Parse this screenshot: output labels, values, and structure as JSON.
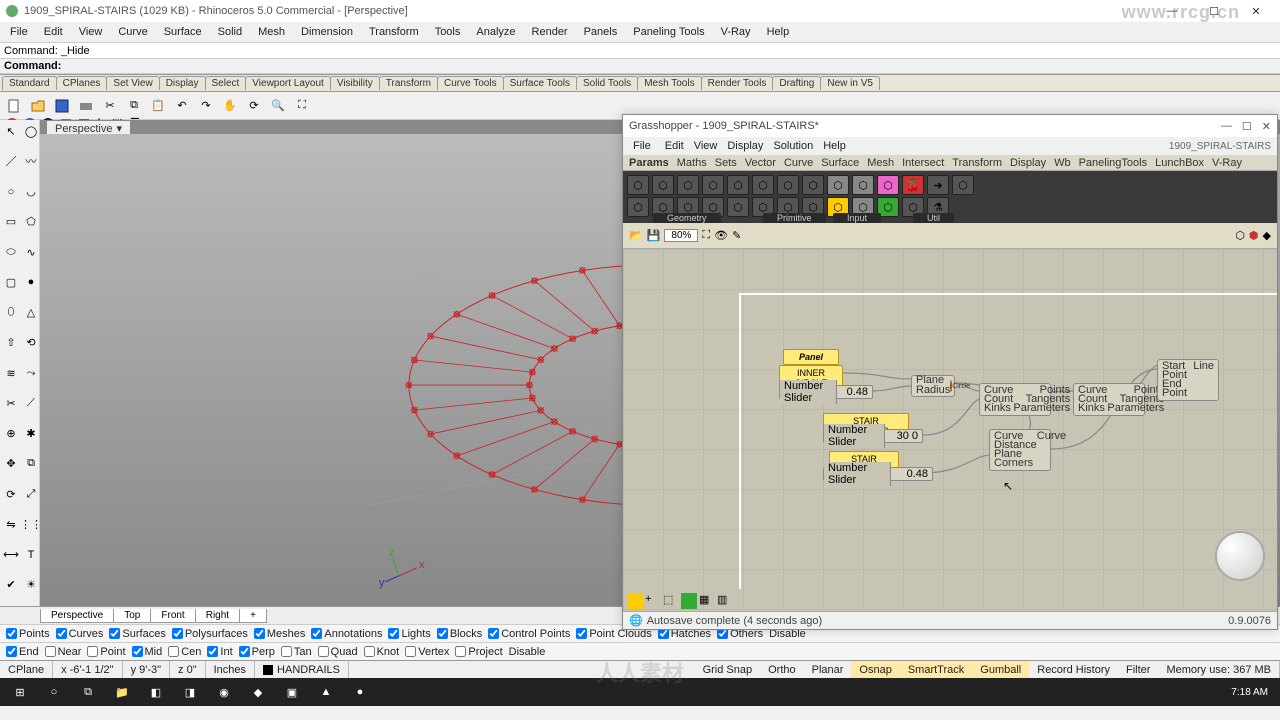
{
  "app": {
    "title": "1909_SPIRAL-STAIRS (1029 KB) - Rhinoceros 5.0 Commercial - [Perspective]",
    "watermark": "www.rrcg.cn",
    "watermark2": "人人素材"
  },
  "menus": [
    "File",
    "Edit",
    "View",
    "Curve",
    "Surface",
    "Solid",
    "Mesh",
    "Dimension",
    "Transform",
    "Tools",
    "Analyze",
    "Render",
    "Panels",
    "Paneling Tools",
    "V-Ray",
    "Help"
  ],
  "command": {
    "history": "Command: _Hide",
    "prompt": "Command:"
  },
  "tabs": [
    "Standard",
    "CPlanes",
    "Set View",
    "Display",
    "Select",
    "Viewport Layout",
    "Visibility",
    "Transform",
    "Curve Tools",
    "Surface Tools",
    "Solid Tools",
    "Mesh Tools",
    "Render Tools",
    "Drafting",
    "New in V5"
  ],
  "viewport": {
    "label": "Perspective"
  },
  "bottom_tabs": [
    "Perspective",
    "Top",
    "Front",
    "Right"
  ],
  "filters1": [
    "End",
    "Near",
    "Point",
    "Mid",
    "Cen",
    "Int",
    "Perp",
    "Tan",
    "Quad",
    "Knot",
    "Vertex",
    "Project",
    "Disable"
  ],
  "filters0": [
    "Points",
    "Curves",
    "Surfaces",
    "Polysurfaces",
    "Meshes",
    "Annotations",
    "Lights",
    "Blocks",
    "Control Points",
    "Point Clouds",
    "Hatches",
    "Others",
    "Disable"
  ],
  "status": {
    "cplane": "CPlane",
    "x": "x -6'-1 1/2\"",
    "y": "y 9'-3\"",
    "z": "z 0\"",
    "units": "Inches",
    "layer": "HANDRAILS",
    "toggles": [
      "Grid Snap",
      "Ortho",
      "Planar",
      "Osnap",
      "SmartTrack",
      "Gumball",
      "Record History",
      "Filter"
    ],
    "mem": "Memory use: 367 MB"
  },
  "taskbar": {
    "time": "7:18 AM"
  },
  "gh": {
    "title": "Grasshopper - 1909_SPIRAL-STAIRS*",
    "doc": "1909_SPIRAL-STAIRS",
    "menus": [
      "File",
      "Edit",
      "View",
      "Display",
      "Solution",
      "Help"
    ],
    "tabs": [
      "Params",
      "Maths",
      "Sets",
      "Vector",
      "Curve",
      "Surface",
      "Mesh",
      "Intersect",
      "Transform",
      "Display",
      "Wb",
      "PanelingTools",
      "LunchBox",
      "V-Ray"
    ],
    "ribbon_groups": [
      "Geometry",
      "Primitive",
      "Input",
      "Util"
    ],
    "zoom": "80%",
    "status": "Autosave complete (4 seconds ago)",
    "version": "0.9.0076",
    "nodes": {
      "panel_hdr": "Panel",
      "inner_circle": "INNER CIRCLE",
      "stair_div": "STAIR DIVISIONS",
      "stair_width": "STAIR WIDTH",
      "slider1": {
        "label": "Number Slider",
        "value": "0.48"
      },
      "slider2": {
        "label": "Number Slider",
        "value": "30 0"
      },
      "slider3": {
        "label": "Number Slider",
        "value": "0.48"
      },
      "circle": {
        "in": [
          "Plane",
          "Radius"
        ],
        "name": "Circle"
      },
      "divide1": {
        "in": [
          "Curve",
          "Count",
          "Kinks"
        ],
        "out": [
          "Points",
          "Tangents",
          "Parameters"
        ]
      },
      "divide2": {
        "in": [
          "Curve",
          "Count",
          "Kinks"
        ],
        "out": [
          "Points",
          "Tangents",
          "Parameters"
        ]
      },
      "offset": {
        "labels": [
          "Curve",
          "Distance",
          "Plane",
          "Corners"
        ],
        "out": "Curve"
      },
      "line": {
        "in": [
          "Start Point",
          "End Point"
        ],
        "name": "Line"
      }
    }
  }
}
